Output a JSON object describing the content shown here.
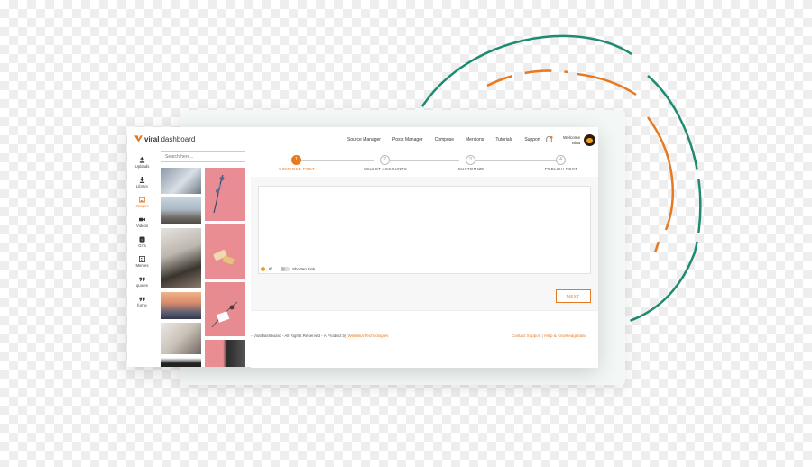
{
  "app": {
    "logo_word1": "viral",
    "logo_word2": "dashboard",
    "brand_color": "#e8791f",
    "accent_green": "#1f8a72"
  },
  "nav": {
    "items": [
      "Source Manager",
      "Posts Manager",
      "Compose",
      "Mentions",
      "Tutorials",
      "Support"
    ]
  },
  "user": {
    "welcome": "Welcome",
    "name": "Nina"
  },
  "sidebar": {
    "items": [
      {
        "label": "Uploads",
        "icon": "upload-icon"
      },
      {
        "label": "Library",
        "icon": "download-icon"
      },
      {
        "label": "Images",
        "icon": "images-icon",
        "active": true
      },
      {
        "label": "Videos",
        "icon": "video-icon"
      },
      {
        "label": "Gif's",
        "icon": "gif-icon"
      },
      {
        "label": "Memes",
        "icon": "meme-icon"
      },
      {
        "label": "quotes",
        "icon": "quote-icon"
      },
      {
        "label": "funny",
        "icon": "quote-icon"
      }
    ]
  },
  "search": {
    "placeholder": "Search here..."
  },
  "steps": [
    {
      "num": "1",
      "label": "COMPOSE POST",
      "active": true
    },
    {
      "num": "2",
      "label": "SELECT ACCOUNTS"
    },
    {
      "num": "3",
      "label": "CUSTOMIZE"
    },
    {
      "num": "4",
      "label": "PUBLISH POST"
    }
  ],
  "editor": {
    "shorten_label": "Shorten Link",
    "hash_symbol": "#"
  },
  "buttons": {
    "next": "NEXT"
  },
  "footer": {
    "copyright_prefix": "- ViralDashboard - All Rights Reserved - A Product by",
    "company": "Webbika Technologies",
    "contact": "Contact Support",
    "help": "Help & Knowledgebase"
  }
}
